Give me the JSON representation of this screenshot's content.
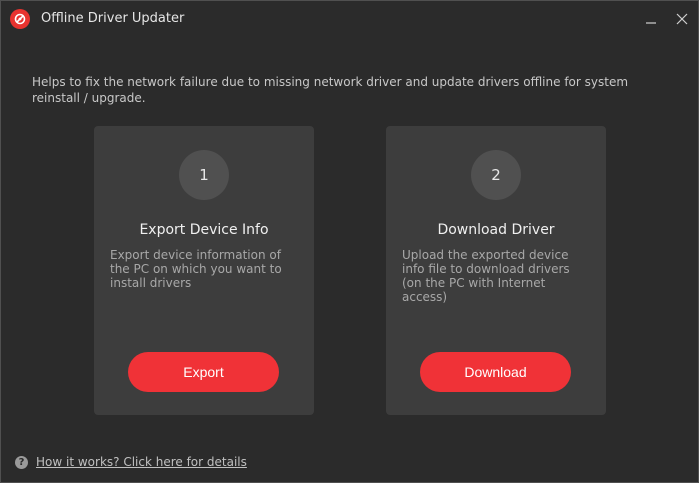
{
  "window": {
    "title": "Offline Driver Updater",
    "minimize_icon": "minimize-icon",
    "close_icon": "close-icon"
  },
  "intro": "Helps to fix the network failure due to missing network driver and update drivers offline for system reinstall / upgrade.",
  "cards": [
    {
      "step": "1",
      "title": "Export Device Info",
      "description": "Export device information of the PC on which you want to install drivers",
      "button": "Export"
    },
    {
      "step": "2",
      "title": "Download Driver",
      "description": "Upload the exported device info file to download drivers (on the PC with Internet access)",
      "button": "Download"
    }
  ],
  "help": {
    "icon": "question-icon",
    "link": "How it works? Click here for details"
  },
  "colors": {
    "background": "#2b2b2b",
    "card": "#3d3d3d",
    "accent": "#f03237"
  }
}
